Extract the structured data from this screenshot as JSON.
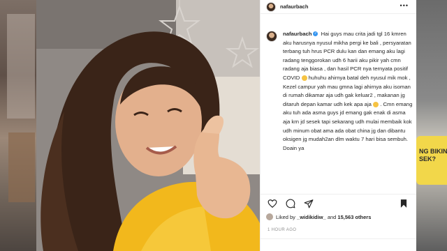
{
  "post": {
    "username": "nafaurbach",
    "more_icon": "more-horizontal-icon",
    "caption": {
      "username": "nafaurbach",
      "text_1": "Hai guys mau crita jadi tgl 16 kmren aku harusnya nyusul mikha pergi ke bali , persyaratan terbang tuh hrus PCR dulu kan dan emang aku lagi radang tenggorokan udh 6 harii aku pikir yah cmn radang aja biasa , dan hasil PCR nya ternyata positif COVID",
      "text_2": "huhuhu ahirnya batal deh nyusul mik mok , Kezel campur yah mau gmna lagi ahirnya aku isoman di rumah dikamar aja udh gak keluar2 , makanan jg ditaruh depan kamar udh kek apa aja",
      "text_3": ". Cmn emang aku tuh ada asma guys jd emang gak enak di asma aja krn jd sesek tapi sekarang udh mulai membaik kok udh minum obat ama ada obat china jg dan dibantu oksigen jg mudah2an dlm waktu 7 hari bisa sembuh. Doain ya"
    },
    "likes": {
      "prefix": "Liked by",
      "user": "_widikidiw_",
      "connector": "and",
      "count": "15,563 others"
    },
    "time": "1 HOUR AGO"
  },
  "background": {
    "promo_text": "NG BIKIN\nSEK?"
  },
  "icons": [
    "heart-icon",
    "comment-icon",
    "share-icon",
    "bookmark-icon",
    "verified-badge-icon"
  ],
  "colors": {
    "verified": "#3897f0",
    "sweater": "#f2b81c",
    "promo": "#f2d74a"
  }
}
